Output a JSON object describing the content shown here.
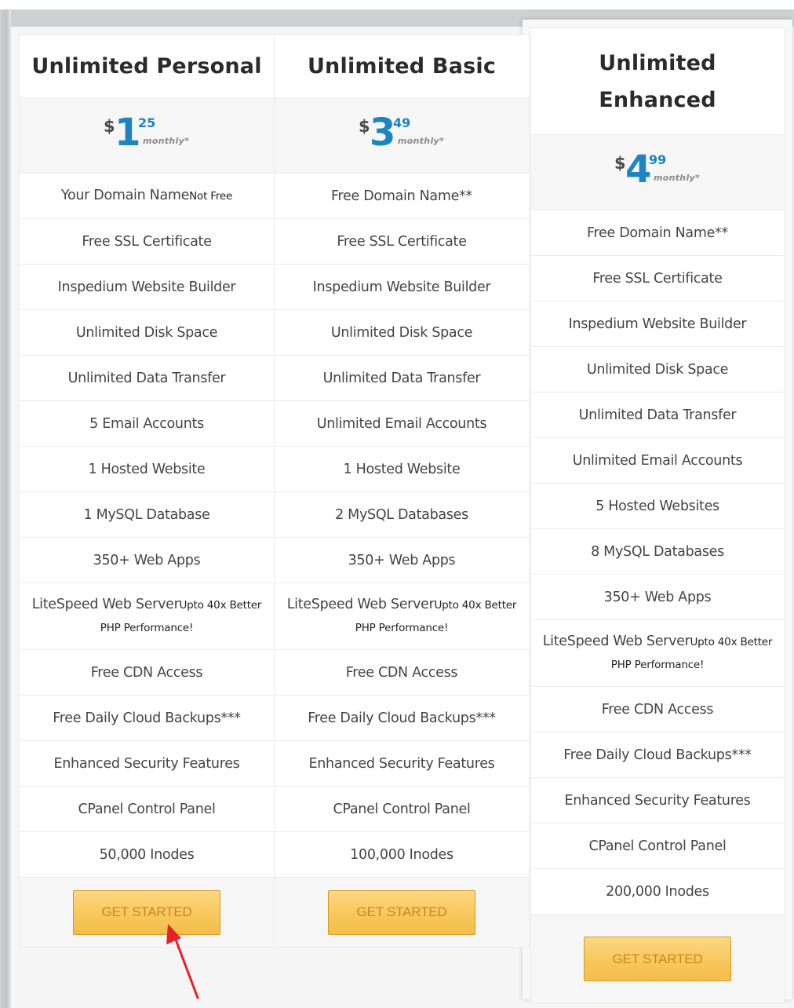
{
  "plans": [
    {
      "name": "Unlimited Personal",
      "price": {
        "currency": "$",
        "whole": "1",
        "cents": "25",
        "period": "monthly*"
      },
      "features": [
        {
          "text": "Your Domain Name",
          "note": "Not Free"
        },
        {
          "text": "Free SSL Certificate"
        },
        {
          "text": "Inspedium Website Builder"
        },
        {
          "text": "Unlimited Disk Space"
        },
        {
          "text": "Unlimited Data Transfer"
        },
        {
          "text": "5 Email Accounts"
        },
        {
          "text": "1 Hosted Website"
        },
        {
          "text": "1 MySQL Database"
        },
        {
          "text": "350+ Web Apps"
        },
        {
          "text": "LiteSpeed Web Server",
          "note": "Upto 40x Better PHP Performance!"
        },
        {
          "text": "Free CDN Access"
        },
        {
          "text": "Free Daily Cloud Backups***"
        },
        {
          "text": "Enhanced Security Features"
        },
        {
          "text": "CPanel Control Panel"
        },
        {
          "text": "50,000 Inodes"
        }
      ],
      "cta": "GET STARTED"
    },
    {
      "name": "Unlimited Basic",
      "price": {
        "currency": "$",
        "whole": "3",
        "cents": "49",
        "period": "monthly*"
      },
      "features": [
        {
          "text": "Free Domain Name**"
        },
        {
          "text": "Free SSL Certificate"
        },
        {
          "text": "Inspedium Website Builder"
        },
        {
          "text": "Unlimited Disk Space"
        },
        {
          "text": "Unlimited Data Transfer"
        },
        {
          "text": "Unlimited Email Accounts"
        },
        {
          "text": "1 Hosted Website"
        },
        {
          "text": "2 MySQL Databases"
        },
        {
          "text": "350+ Web Apps"
        },
        {
          "text": "LiteSpeed Web Server",
          "note": "Upto 40x Better PHP Performance!"
        },
        {
          "text": "Free CDN Access"
        },
        {
          "text": "Free Daily Cloud Backups***"
        },
        {
          "text": "Enhanced Security Features"
        },
        {
          "text": "CPanel Control Panel"
        },
        {
          "text": "100,000 Inodes"
        }
      ],
      "cta": "GET STARTED"
    },
    {
      "name": "Unlimited Enhanced",
      "featured": true,
      "price": {
        "currency": "$",
        "whole": "4",
        "cents": "99",
        "period": "monthly*"
      },
      "features": [
        {
          "text": "Free Domain Name**"
        },
        {
          "text": "Free SSL Certificate"
        },
        {
          "text": "Inspedium Website Builder"
        },
        {
          "text": "Unlimited Disk Space"
        },
        {
          "text": "Unlimited Data Transfer"
        },
        {
          "text": "Unlimited Email Accounts"
        },
        {
          "text": "5 Hosted Websites"
        },
        {
          "text": "8 MySQL Databases"
        },
        {
          "text": "350+ Web Apps"
        },
        {
          "text": "LiteSpeed Web Server",
          "note": "Upto 40x Better PHP Performance!"
        },
        {
          "text": "Free CDN Access"
        },
        {
          "text": "Free Daily Cloud Backups***"
        },
        {
          "text": "Enhanced Security Features"
        },
        {
          "text": "CPanel Control Panel"
        },
        {
          "text": "200,000 Inodes"
        }
      ],
      "cta": "GET STARTED"
    }
  ],
  "colors": {
    "price_accent": "#1c84c0",
    "cta_background": "#f7c65a",
    "cta_text": "#c9881a",
    "annotation_arrow": "#e8202a"
  },
  "annotation": {
    "type": "arrow",
    "target": "plans.0.cta"
  }
}
